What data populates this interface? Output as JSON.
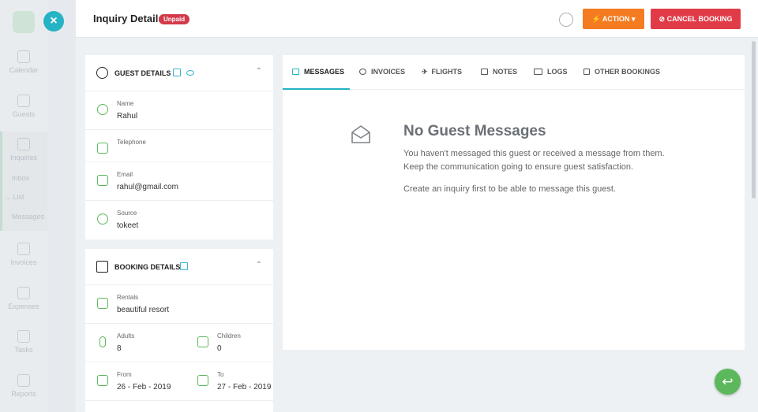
{
  "sidebar": {
    "items": [
      {
        "label": "Calendar",
        "icon": "calendar-icon"
      },
      {
        "label": "Guests",
        "icon": "guests-icon"
      },
      {
        "label": "Inquiries",
        "icon": "inquiries-icon"
      },
      {
        "label": "Invoices",
        "icon": "invoices-icon"
      },
      {
        "label": "Expenses",
        "icon": "expenses-icon"
      },
      {
        "label": "Tasks",
        "icon": "tasks-icon"
      },
      {
        "label": "Reports",
        "icon": "reports-icon"
      }
    ],
    "sub_items": [
      "Inbox",
      "List",
      "Messages"
    ],
    "arrow": "→"
  },
  "modal": {
    "title": "Inquiry Details",
    "badge": "Unpaid",
    "action_label": "ACTION",
    "cancel_label": "CANCEL BOOKING",
    "close_glyph": "×"
  },
  "guest_details": {
    "heading": "GUEST DETAILS",
    "fields": [
      {
        "label": "Name",
        "value": "Rahul"
      },
      {
        "label": "Telephone",
        "value": ""
      },
      {
        "label": "Email",
        "value": "rahul@gmail.com"
      },
      {
        "label": "Source",
        "value": "tokeet"
      }
    ]
  },
  "booking_details": {
    "heading": "BOOKING DETAILS",
    "rentals_label": "Rentals",
    "rentals_value": "beautiful resort",
    "adults_label": "Adults",
    "adults_value": "8",
    "children_label": "Children",
    "children_value": "0",
    "from_label": "From",
    "from_value": "26 - Feb - 2019",
    "to_label": "To",
    "to_value": "27 - Feb - 2019"
  },
  "tabs": [
    {
      "label": "MESSAGES",
      "icon": "envelope-icon"
    },
    {
      "label": "INVOICES",
      "icon": "dollar-icon"
    },
    {
      "label": "FLIGHTS",
      "icon": "plane-icon"
    },
    {
      "label": "NOTES",
      "icon": "notes-icon"
    },
    {
      "label": "LOGS",
      "icon": "book-icon"
    },
    {
      "label": "OTHER BOOKINGS",
      "icon": "calendar-check-icon"
    }
  ],
  "empty_state": {
    "title": "No Guest Messages",
    "line1": "You haven't messaged this guest or received a message from them.",
    "line2": "Keep the communication going to ensure guest satisfaction.",
    "line3": "Create an inquiry first to be able to message this guest."
  },
  "colors": {
    "accent": "#26b3c4",
    "action": "#f47b20",
    "danger": "#e23b48",
    "success": "#5cb85c"
  }
}
